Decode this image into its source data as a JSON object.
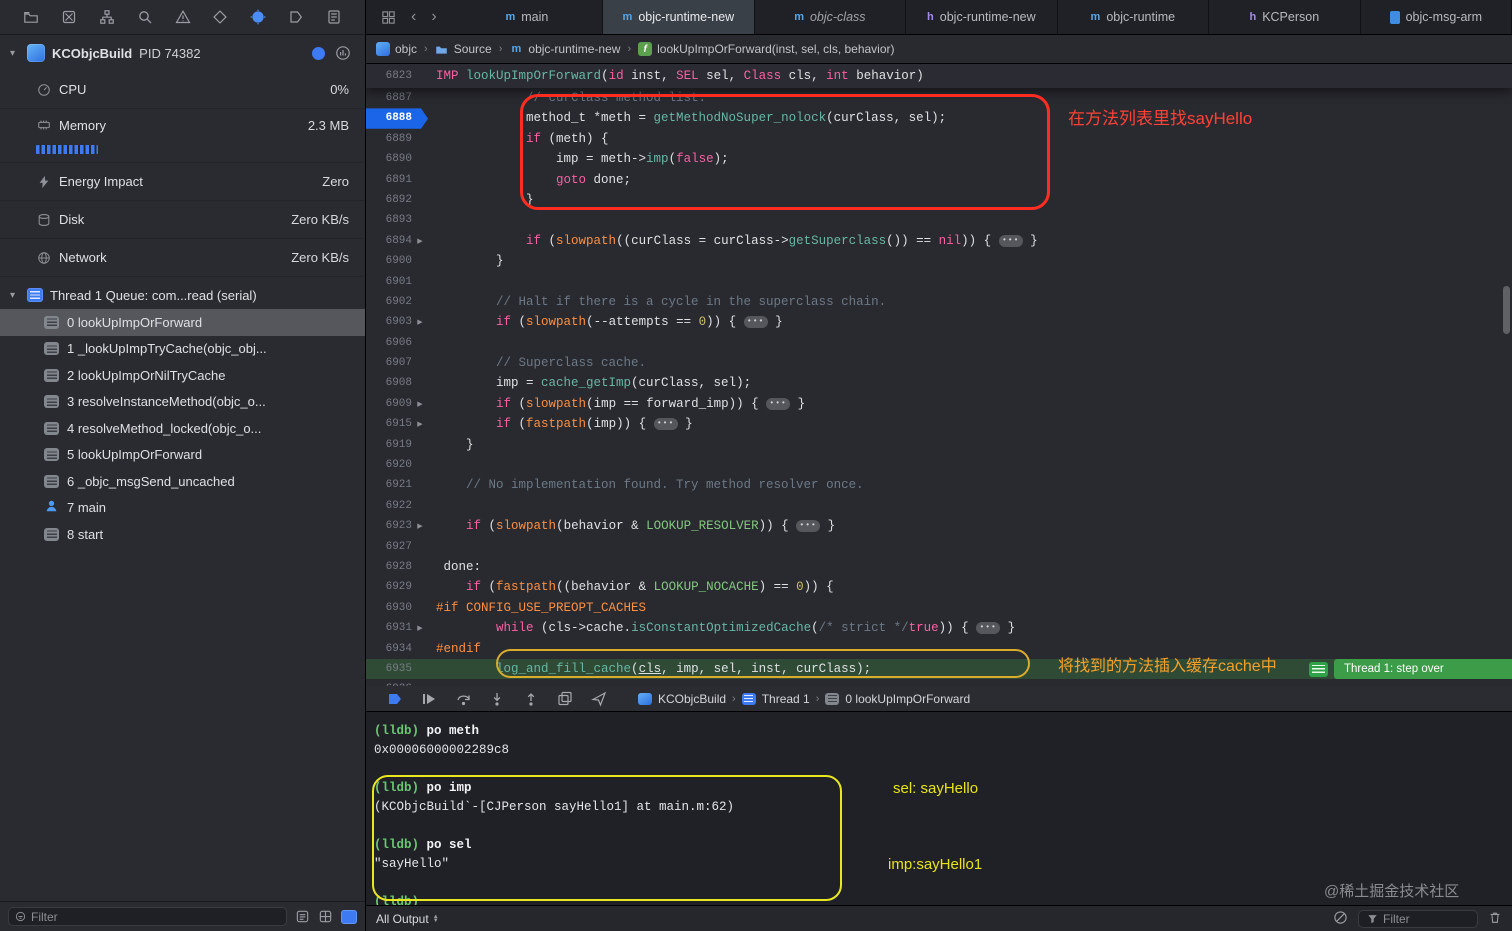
{
  "colors": {
    "accent_blue": "#3E7BF2",
    "exec_line_blue": "#1B66E8",
    "step_badge_green": "#3C9C47",
    "annotation_red": "#FF2D21",
    "annotation_orange": "#F5A028",
    "annotation_yellow": "#E9E71E",
    "prompt_green": "#69C86F"
  },
  "sidebar": {
    "process": {
      "name": "KCObjcBuild",
      "pid": "PID 74382"
    },
    "gauges": [
      {
        "label": "CPU",
        "value": "0%",
        "icon": "cpu"
      },
      {
        "label": "Memory",
        "value": "2.3 MB",
        "icon": "memory",
        "bar": true
      },
      {
        "label": "Energy Impact",
        "value": "Zero",
        "icon": "energy"
      },
      {
        "label": "Disk",
        "value": "Zero KB/s",
        "icon": "disk"
      },
      {
        "label": "Network",
        "value": "Zero KB/s",
        "icon": "network"
      }
    ],
    "thread_label": "Thread 1 Queue: com...read (serial)",
    "frames": [
      {
        "label": "0 lookUpImpOrForward",
        "icon": "frame",
        "selected": true
      },
      {
        "label": "1 _lookUpImpTryCache(objc_obj...",
        "icon": "frame"
      },
      {
        "label": "2 lookUpImpOrNilTryCache",
        "icon": "frame"
      },
      {
        "label": "3 resolveInstanceMethod(objc_o...",
        "icon": "frame"
      },
      {
        "label": "4 resolveMethod_locked(objc_o...",
        "icon": "frame"
      },
      {
        "label": "5 lookUpImpOrForward",
        "icon": "frame"
      },
      {
        "label": "6 _objc_msgSend_uncached",
        "icon": "frame"
      },
      {
        "label": "7 main",
        "icon": "user"
      },
      {
        "label": "8 start",
        "icon": "frame"
      }
    ],
    "filter_placeholder": "Filter"
  },
  "tabs": [
    {
      "icon": "m",
      "label": "main"
    },
    {
      "icon": "m",
      "label": "objc-runtime-new",
      "active": true
    },
    {
      "icon": "m",
      "label": "objc-class",
      "italic": true
    },
    {
      "icon": "h",
      "label": "objc-runtime-new"
    },
    {
      "icon": "m",
      "label": "objc-runtime"
    },
    {
      "icon": "h",
      "label": "KCPerson"
    },
    {
      "icon": "doc",
      "label": "objc-msg-arm"
    }
  ],
  "jumpbar": [
    {
      "icon": "project",
      "label": "objc"
    },
    {
      "icon": "folder",
      "label": "Source"
    },
    {
      "icon": "m",
      "label": "objc-runtime-new"
    },
    {
      "icon": "func",
      "label": "lookUpImpOrForward(inst, sel, cls, behavior)"
    }
  ],
  "editor": {
    "sticky": {
      "n": "6823",
      "toks": [
        [
          "k",
          "IMP"
        ],
        [
          "p",
          " "
        ],
        [
          "f",
          "lookUpImpOrForward"
        ],
        [
          "p",
          "("
        ],
        [
          "k",
          "id"
        ],
        [
          "p",
          " inst, "
        ],
        [
          "k",
          "SEL"
        ],
        [
          "p",
          " sel, "
        ],
        [
          "k",
          "Class"
        ],
        [
          "p",
          " cls, "
        ],
        [
          "k",
          "int"
        ],
        [
          "p",
          " behavior)"
        ]
      ]
    },
    "lines": [
      {
        "n": "6887",
        "toks": [
          [
            "c",
            "            // curClass method list."
          ]
        ]
      },
      {
        "n": "6888",
        "cls": "cur",
        "toks": [
          [
            "p",
            "            method_t *meth = "
          ],
          [
            "f",
            "getMethodNoSuper_nolock"
          ],
          [
            "p",
            "(curClass, sel);"
          ]
        ]
      },
      {
        "n": "6889",
        "toks": [
          [
            "p",
            "            "
          ],
          [
            "k",
            "if"
          ],
          [
            "p",
            " (meth) {"
          ]
        ]
      },
      {
        "n": "6890",
        "toks": [
          [
            "p",
            "                imp = meth->"
          ],
          [
            "f",
            "imp"
          ],
          [
            "p",
            "("
          ],
          [
            "k",
            "false"
          ],
          [
            "p",
            ");"
          ]
        ]
      },
      {
        "n": "6891",
        "toks": [
          [
            "p",
            "                "
          ],
          [
            "k",
            "goto"
          ],
          [
            "p",
            " done;"
          ]
        ]
      },
      {
        "n": "6892",
        "toks": [
          [
            "p",
            "            }"
          ]
        ]
      },
      {
        "n": "6893",
        "toks": []
      },
      {
        "n": "6894",
        "fold": true,
        "toks": [
          [
            "p",
            "            "
          ],
          [
            "k",
            "if"
          ],
          [
            "p",
            " ("
          ],
          [
            "m",
            "slowpath"
          ],
          [
            "p",
            "((curClass = curClass->"
          ],
          [
            "f",
            "getSuperclass"
          ],
          [
            "p",
            "()) == "
          ],
          [
            "k",
            "nil"
          ],
          [
            "p",
            ")) { "
          ],
          [
            "e",
            ""
          ],
          [
            "p",
            " }"
          ]
        ]
      },
      {
        "n": "6900",
        "toks": [
          [
            "p",
            "        }"
          ]
        ]
      },
      {
        "n": "6901",
        "toks": []
      },
      {
        "n": "6902",
        "toks": [
          [
            "c",
            "        // Halt if there is a cycle in the superclass chain."
          ]
        ]
      },
      {
        "n": "6903",
        "fold": true,
        "toks": [
          [
            "p",
            "        "
          ],
          [
            "k",
            "if"
          ],
          [
            "p",
            " ("
          ],
          [
            "m",
            "slowpath"
          ],
          [
            "p",
            "(--attempts == "
          ],
          [
            "n2",
            "0"
          ],
          [
            "p",
            ")) { "
          ],
          [
            "e",
            ""
          ],
          [
            "p",
            " }"
          ]
        ]
      },
      {
        "n": "6906",
        "toks": []
      },
      {
        "n": "6907",
        "toks": [
          [
            "c",
            "        // Superclass cache."
          ]
        ]
      },
      {
        "n": "6908",
        "toks": [
          [
            "p",
            "        imp = "
          ],
          [
            "f",
            "cache_getImp"
          ],
          [
            "p",
            "(curClass, sel);"
          ]
        ]
      },
      {
        "n": "6909",
        "fold": true,
        "toks": [
          [
            "p",
            "        "
          ],
          [
            "k",
            "if"
          ],
          [
            "p",
            " ("
          ],
          [
            "m",
            "slowpath"
          ],
          [
            "p",
            "(imp == forward_imp)) { "
          ],
          [
            "e",
            ""
          ],
          [
            "p",
            " }"
          ]
        ]
      },
      {
        "n": "6915",
        "fold": true,
        "toks": [
          [
            "p",
            "        "
          ],
          [
            "k",
            "if"
          ],
          [
            "p",
            " ("
          ],
          [
            "m",
            "fastpath"
          ],
          [
            "p",
            "(imp)) { "
          ],
          [
            "e",
            ""
          ],
          [
            "p",
            " }"
          ]
        ]
      },
      {
        "n": "6919",
        "toks": [
          [
            "p",
            "    }"
          ]
        ]
      },
      {
        "n": "6920",
        "toks": []
      },
      {
        "n": "6921",
        "toks": [
          [
            "c",
            "    // No implementation found. Try method resolver once."
          ]
        ]
      },
      {
        "n": "6922",
        "toks": []
      },
      {
        "n": "6923",
        "fold": true,
        "toks": [
          [
            "p",
            "    "
          ],
          [
            "k",
            "if"
          ],
          [
            "p",
            " ("
          ],
          [
            "m",
            "slowpath"
          ],
          [
            "p",
            "(behavior & "
          ],
          [
            "g",
            "LOOKUP_RESOLVER"
          ],
          [
            "p",
            ")) { "
          ],
          [
            "e",
            ""
          ],
          [
            "p",
            " }"
          ]
        ]
      },
      {
        "n": "6927",
        "toks": []
      },
      {
        "n": "6928",
        "toks": [
          [
            "p",
            " done:"
          ]
        ]
      },
      {
        "n": "6929",
        "toks": [
          [
            "p",
            "    "
          ],
          [
            "k",
            "if"
          ],
          [
            "p",
            " ("
          ],
          [
            "m",
            "fastpath"
          ],
          [
            "p",
            "((behavior & "
          ],
          [
            "g",
            "LOOKUP_NOCACHE"
          ],
          [
            "p",
            ") == "
          ],
          [
            "n2",
            "0"
          ],
          [
            "p",
            ")) {"
          ]
        ]
      },
      {
        "n": "6930",
        "toks": [
          [
            "m",
            "#if CONFIG_USE_PREOPT_CACHES"
          ]
        ]
      },
      {
        "n": "6931",
        "fold": true,
        "toks": [
          [
            "p",
            "        "
          ],
          [
            "k",
            "while"
          ],
          [
            "p",
            " (cls->cache."
          ],
          [
            "f",
            "isConstantOptimizedCache"
          ],
          [
            "p",
            "("
          ],
          [
            "c",
            "/* strict */"
          ],
          [
            "k",
            "true"
          ],
          [
            "p",
            ")) { "
          ],
          [
            "e",
            ""
          ],
          [
            "p",
            " }"
          ]
        ]
      },
      {
        "n": "6934",
        "toks": [
          [
            "m",
            "#endif"
          ]
        ]
      },
      {
        "n": "6935",
        "cls": "green",
        "toks": [
          [
            "p",
            "        "
          ],
          [
            "f",
            "log_and_fill_cache"
          ],
          [
            "p",
            "("
          ],
          [
            "u",
            "cls"
          ],
          [
            "p",
            ", imp, sel, inst, curClass);"
          ]
        ]
      },
      {
        "n": "6936",
        "toks": []
      }
    ],
    "badge": {
      "text": "Thread 1: step over"
    },
    "annotations": {
      "red_note": "在方法列表里找sayHello",
      "orange_note": "将找到的方法插入缓存cache中"
    }
  },
  "debugbar": {
    "crumbs": [
      {
        "icon": "app",
        "label": "KCObjcBuild"
      },
      {
        "icon": "thread",
        "label": "Thread 1"
      },
      {
        "icon": "frame",
        "label": "0 lookUpImpOrForward"
      }
    ]
  },
  "console": {
    "lines": [
      [
        [
          "prompt",
          "(lldb) "
        ],
        [
          "cmd",
          "po meth"
        ]
      ],
      [
        [
          "out",
          "0x00006000002289c8"
        ]
      ],
      [],
      [
        [
          "prompt",
          "(lldb) "
        ],
        [
          "cmd",
          "po imp"
        ]
      ],
      [
        [
          "out",
          "(KCObjcBuild`-[CJPerson sayHello1] at main.m:62)"
        ]
      ],
      [],
      [
        [
          "prompt",
          "(lldb) "
        ],
        [
          "cmd",
          "po sel"
        ]
      ],
      [
        [
          "out",
          "\"sayHello\""
        ]
      ],
      [],
      [
        [
          "prompt",
          "(lldb)"
        ]
      ]
    ],
    "annotations": {
      "sel_note": "sel: sayHello",
      "imp_note": "imp:sayHello1",
      "watermark": "@稀土掘金技术社区"
    },
    "bottom": {
      "output_label": "All Output",
      "filter_placeholder": "Filter"
    }
  }
}
